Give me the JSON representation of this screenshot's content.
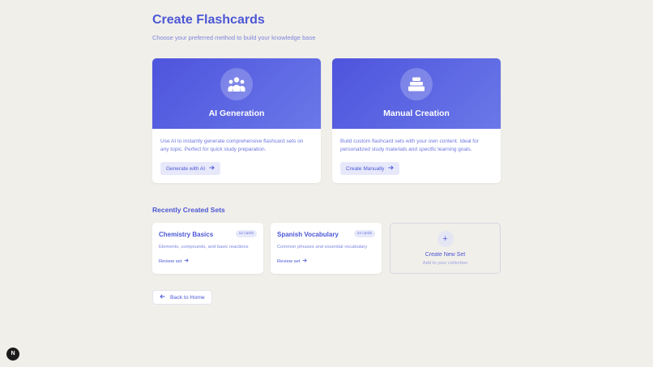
{
  "header": {
    "title": "Create Flashcards",
    "subtitle": "Choose your preferred method to build your knowledge base"
  },
  "methods": [
    {
      "title": "AI Generation",
      "icon": "users-icon",
      "description": "Use AI to instantly generate comprehensive flashcard sets on any topic. Perfect for quick study preparation.",
      "button": "Generate with AI"
    },
    {
      "title": "Manual Creation",
      "icon": "stack-icon",
      "description": "Build custom flashcard sets with your own content. Ideal for personalized study materials and specific learning goals.",
      "button": "Create Manually"
    }
  ],
  "recent": {
    "title": "Recently Created Sets",
    "sets": [
      {
        "name": "Chemistry Basics",
        "badge": "12 cards",
        "description": "Elements, compounds, and basic reactions",
        "link": "Review set"
      },
      {
        "name": "Spanish Vocabulary",
        "badge": "24 cards",
        "description": "Common phrases and essential vocabulary",
        "link": "Review set"
      }
    ],
    "new_set": {
      "plus": "+",
      "title": "Create New Set",
      "subtitle": "Add to your collection"
    }
  },
  "footer": {
    "back_label": "Back to Home",
    "badge_letter": "N"
  },
  "colors": {
    "accent": "#4b57d6",
    "background": "#f1efe9",
    "gradient_start": "#4e54dd",
    "gradient_end": "#6a78e8"
  }
}
